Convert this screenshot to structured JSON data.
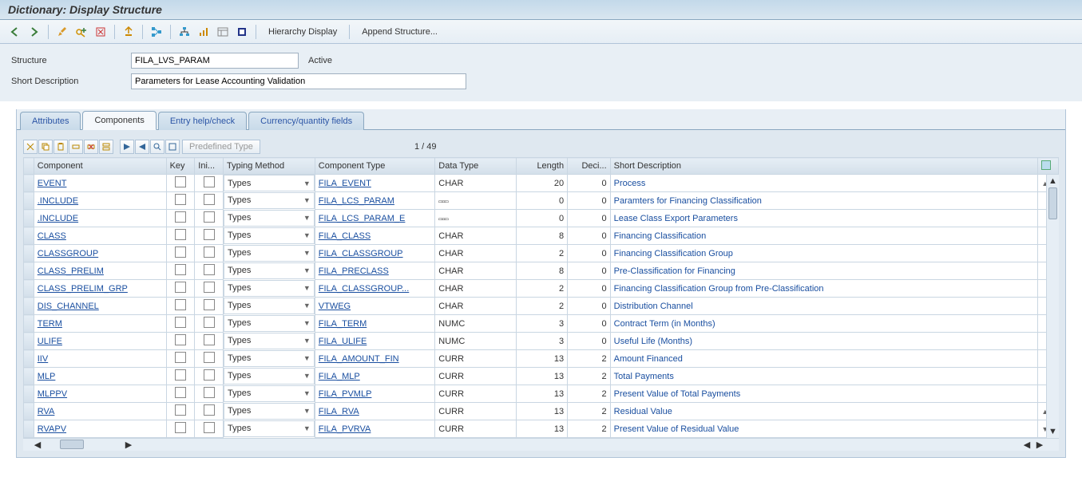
{
  "title": "Dictionary: Display Structure",
  "toolbar_buttons": {
    "hierarchy": "Hierarchy Display",
    "append": "Append Structure..."
  },
  "form": {
    "structure_label": "Structure",
    "structure_value": "FILA_LVS_PARAM",
    "status": "Active",
    "desc_label": "Short Description",
    "desc_value": "Parameters for Lease Accounting Validation"
  },
  "tabs": [
    {
      "id": "attributes",
      "label": "Attributes",
      "active": false
    },
    {
      "id": "components",
      "label": "Components",
      "active": true
    },
    {
      "id": "entryhelp",
      "label": "Entry help/check",
      "active": false
    },
    {
      "id": "currency",
      "label": "Currency/quantity fields",
      "active": false
    }
  ],
  "inner": {
    "predefined": "Predefined Type",
    "counter": "1  /  49"
  },
  "columns": {
    "component": "Component",
    "key": "Key",
    "ini": "Ini...",
    "typing": "Typing Method",
    "comptype": "Component Type",
    "datatype": "Data Type",
    "length": "Length",
    "deci": "Deci...",
    "shortdesc": "Short Description"
  },
  "rows": [
    {
      "component": "EVENT",
      "typing": "Types",
      "comptype": "FILA_EVENT",
      "datatype": "CHAR",
      "length": "20",
      "deci": "0",
      "desc": "Process",
      "struct": false
    },
    {
      "component": ".INCLUDE",
      "typing": "Types",
      "comptype": "FILA_LCS_PARAM",
      "datatype": "",
      "length": "0",
      "deci": "0",
      "desc": "Paramters for Financing Classification",
      "struct": true
    },
    {
      "component": ".INCLUDE",
      "typing": "Types",
      "comptype": "FILA_LCS_PARAM_E",
      "datatype": "",
      "length": "0",
      "deci": "0",
      "desc": "Lease Class Export Parameters",
      "struct": true
    },
    {
      "component": "CLASS",
      "typing": "Types",
      "comptype": "FILA_CLASS",
      "datatype": "CHAR",
      "length": "8",
      "deci": "0",
      "desc": "Financing Classification",
      "struct": false
    },
    {
      "component": "CLASSGROUP",
      "typing": "Types",
      "comptype": "FILA_CLASSGROUP",
      "datatype": "CHAR",
      "length": "2",
      "deci": "0",
      "desc": "Financing Classification Group",
      "struct": false
    },
    {
      "component": "CLASS_PRELIM",
      "typing": "Types",
      "comptype": "FILA_PRECLASS",
      "datatype": "CHAR",
      "length": "8",
      "deci": "0",
      "desc": "Pre-Classification for Financing",
      "struct": false
    },
    {
      "component": "CLASS_PRELIM_GRP",
      "typing": "Types",
      "comptype": "FILA_CLASSGROUP...",
      "datatype": "CHAR",
      "length": "2",
      "deci": "0",
      "desc": "Financing Classification Group from Pre-Classification",
      "struct": false
    },
    {
      "component": "DIS_CHANNEL",
      "typing": "Types",
      "comptype": "VTWEG",
      "datatype": "CHAR",
      "length": "2",
      "deci": "0",
      "desc": "Distribution Channel",
      "struct": false
    },
    {
      "component": "TERM",
      "typing": "Types",
      "comptype": "FILA_TERM",
      "datatype": "NUMC",
      "length": "3",
      "deci": "0",
      "desc": "Contract Term (in Months)",
      "struct": false
    },
    {
      "component": "ULIFE",
      "typing": "Types",
      "comptype": "FILA_ULIFE",
      "datatype": "NUMC",
      "length": "3",
      "deci": "0",
      "desc": "Useful Life (Months)",
      "struct": false
    },
    {
      "component": "IIV",
      "typing": "Types",
      "comptype": "FILA_AMOUNT_FIN",
      "datatype": "CURR",
      "length": "13",
      "deci": "2",
      "desc": "Amount Financed",
      "struct": false
    },
    {
      "component": "MLP",
      "typing": "Types",
      "comptype": "FILA_MLP",
      "datatype": "CURR",
      "length": "13",
      "deci": "2",
      "desc": "Total Payments",
      "struct": false
    },
    {
      "component": "MLPPV",
      "typing": "Types",
      "comptype": "FILA_PVMLP",
      "datatype": "CURR",
      "length": "13",
      "deci": "2",
      "desc": "Present Value of Total Payments",
      "struct": false
    },
    {
      "component": "RVA",
      "typing": "Types",
      "comptype": "FILA_RVA",
      "datatype": "CURR",
      "length": "13",
      "deci": "2",
      "desc": "Residual Value",
      "struct": false
    },
    {
      "component": "RVAPV",
      "typing": "Types",
      "comptype": "FILA_PVRVA",
      "datatype": "CURR",
      "length": "13",
      "deci": "2",
      "desc": "Present Value of Residual Value",
      "struct": false
    }
  ]
}
